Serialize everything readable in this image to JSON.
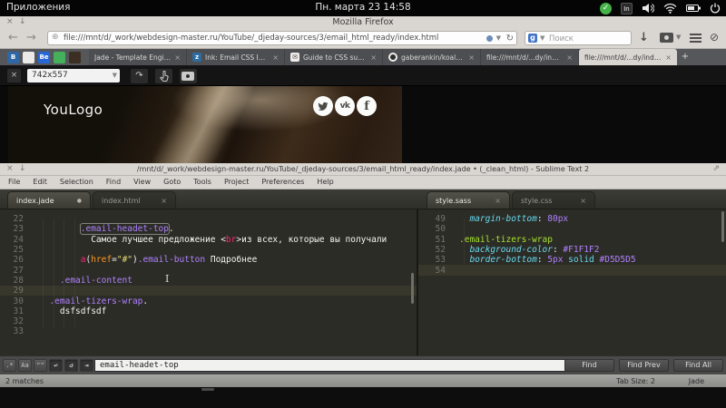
{
  "desktop": {
    "apps_label": "Приложения",
    "clock": "Пн. марта 23  14:58",
    "tray_icons": [
      "updates",
      "text-tool",
      "volume",
      "wifi",
      "battery",
      "power"
    ]
  },
  "firefox": {
    "window_title": "Mozilla Firefox",
    "url": "file:///mnt/d/_work/webdesign-master.ru/YouTube/_djeday-sources/3/email_html_ready/index.html",
    "search_placeholder": "Поиск",
    "bookmarks": [
      {
        "name": "bootstrap",
        "glyph": "B",
        "bg": "#2f67a6",
        "fg": "#ffffff"
      },
      {
        "name": "red-doc",
        "glyph": "",
        "bg": "#eceae8",
        "fg": "#cc3333"
      },
      {
        "name": "behance",
        "glyph": "Be",
        "bg": "#2766d6",
        "fg": "#ffffff"
      },
      {
        "name": "koala-green",
        "glyph": "",
        "bg": "#45b05c",
        "fg": "#ffffff"
      },
      {
        "name": "dark-folder",
        "glyph": "",
        "bg": "#3c2e22",
        "fg": "#ffffff"
      }
    ],
    "tabs": [
      {
        "label": "Jade - Template Engine",
        "icon": null,
        "active": false
      },
      {
        "label": "Ink: Email CSS Inliner",
        "icon": "ink",
        "active": false
      },
      {
        "label": "Guide to CSS support i...",
        "icon": "mail",
        "active": false
      },
      {
        "label": "gaberankin/koala-jade",
        "icon": "github",
        "active": false
      },
      {
        "label": "file:///mnt/d/...dy/index.html",
        "icon": null,
        "active": false
      },
      {
        "label": "file:///mnt/d/...dy/index.html",
        "icon": null,
        "active": true
      }
    ],
    "favicon_glyphs": {
      "ink": "z",
      "mail": "✉",
      "github": ""
    },
    "new_tab_label": "+",
    "close_glyph": "×",
    "responsive": {
      "size_value": "742x557"
    },
    "page": {
      "logo_text": "YouLogo",
      "social": [
        "twitter",
        "vk",
        "facebook"
      ],
      "vk_glyph": "vk",
      "facebook_glyph": "f"
    }
  },
  "sublime": {
    "window_title": "/mnt/d/_work/webdesign-master.ru/YouTube/_djeday-sources/3/email_html_ready/index.jade • (_clean_html) - Sublime Text 2",
    "menu_items": [
      "File",
      "Edit",
      "Selection",
      "Find",
      "View",
      "Goto",
      "Tools",
      "Project",
      "Preferences",
      "Help"
    ],
    "left_group_tabs": [
      {
        "label": "index.jade",
        "active": true,
        "modified": true
      },
      {
        "label": "index.html",
        "active": false,
        "modified": false
      }
    ],
    "right_group_tabs": [
      {
        "label": "style.sass",
        "active": true,
        "modified": false
      },
      {
        "label": "style.css",
        "active": false,
        "modified": false
      }
    ],
    "left_pane_lines": [
      {
        "n": "22",
        "tokens": []
      },
      {
        "n": "23",
        "tokens": [
          {
            "t": "        ",
            "c": "fg"
          },
          {
            "t": ".email-headet-top",
            "c": "purple",
            "match": true
          },
          {
            "t": ".",
            "c": "fg"
          }
        ]
      },
      {
        "n": "24",
        "tokens": [
          {
            "t": "          Самое лучшее предложение ",
            "c": "fg"
          },
          {
            "t": "<",
            "c": "fg"
          },
          {
            "t": "br",
            "c": "pink"
          },
          {
            "t": ">",
            "c": "fg"
          },
          {
            "t": "из всех, которые вы получали",
            "c": "fg"
          }
        ]
      },
      {
        "n": "25",
        "tokens": []
      },
      {
        "n": "26",
        "tokens": [
          {
            "t": "        ",
            "c": "fg"
          },
          {
            "t": "a",
            "c": "pink"
          },
          {
            "t": "(",
            "c": "fg"
          },
          {
            "t": "href",
            "c": "orange"
          },
          {
            "t": "=",
            "c": "fg"
          },
          {
            "t": "\"#\"",
            "c": "yellow"
          },
          {
            "t": ")",
            "c": "fg"
          },
          {
            "t": ".email-button",
            "c": "purple"
          },
          {
            "t": " Подробнее",
            "c": "fg"
          }
        ]
      },
      {
        "n": "27",
        "tokens": []
      },
      {
        "n": "28",
        "tokens": [
          {
            "t": "    ",
            "c": "fg"
          },
          {
            "t": ".email-content",
            "c": "purple"
          }
        ]
      },
      {
        "n": "29",
        "tokens": [],
        "current": true
      },
      {
        "n": "30",
        "tokens": [
          {
            "t": "  ",
            "c": "fg"
          },
          {
            "t": ".email-tizers-wrap",
            "c": "purple"
          },
          {
            "t": ".",
            "c": "fg"
          }
        ]
      },
      {
        "n": "31",
        "tokens": [
          {
            "t": "    ",
            "c": "fg"
          },
          {
            "t": "dsfsdfsdf",
            "c": "fg"
          }
        ]
      },
      {
        "n": "32",
        "tokens": []
      },
      {
        "n": "33",
        "tokens": []
      }
    ],
    "right_pane_lines": [
      {
        "n": "49",
        "tokens": [
          {
            "t": "  ",
            "c": "fg"
          },
          {
            "t": "margin-bottom",
            "c": "cyani"
          },
          {
            "t": ": ",
            "c": "fg"
          },
          {
            "t": "80px",
            "c": "purple"
          }
        ]
      },
      {
        "n": "50",
        "tokens": []
      },
      {
        "n": "51",
        "tokens": [
          {
            "t": ".email-tizers-wrap",
            "c": "green"
          }
        ]
      },
      {
        "n": "52",
        "tokens": [
          {
            "t": "  ",
            "c": "fg"
          },
          {
            "t": "background-color",
            "c": "cyani"
          },
          {
            "t": ": ",
            "c": "fg"
          },
          {
            "t": "#F1F1F2",
            "c": "purple"
          }
        ]
      },
      {
        "n": "53",
        "tokens": [
          {
            "t": "  ",
            "c": "fg"
          },
          {
            "t": "border-bottom",
            "c": "cyani"
          },
          {
            "t": ": ",
            "c": "fg"
          },
          {
            "t": "5px",
            "c": "purple"
          },
          {
            "t": " ",
            "c": "fg"
          },
          {
            "t": "solid",
            "c": "cyan"
          },
          {
            "t": " ",
            "c": "fg"
          },
          {
            "t": "#D5D5D5",
            "c": "purple"
          }
        ]
      },
      {
        "n": "54",
        "tokens": [],
        "current": true
      }
    ],
    "find_bar": {
      "toggles": [
        {
          "name": "regex",
          "glyph": ".*",
          "on": false
        },
        {
          "name": "case-sensitive",
          "glyph": "Aa",
          "on": false
        },
        {
          "name": "whole-word",
          "glyph": "\"\"",
          "on": false
        },
        {
          "name": "wrap",
          "glyph": "↩",
          "on": true
        },
        {
          "name": "in-selection",
          "glyph": "↺",
          "on": true
        },
        {
          "name": "highlight-matches",
          "glyph": "⇥",
          "on": true
        },
        {
          "name": "preserve-case",
          "glyph": "□",
          "on": false
        }
      ],
      "query": "email-headet-top",
      "buttons": [
        "Find",
        "Find Prev",
        "Find All"
      ]
    },
    "status_bar": {
      "matches": "2 matches",
      "tab_size": "Tab Size: 2",
      "syntax": "Jade"
    }
  },
  "colors": {
    "monokai_purple": "#ae81ff",
    "monokai_pink": "#f92672",
    "monokai_yellow": "#e6db74",
    "monokai_green": "#a6e22e",
    "monokai_cyan": "#66d9ef",
    "monokai_orange": "#fd971f",
    "editor_bg": "#2c2c26",
    "chrome_gray": "#d9d5d1",
    "tabstrip_gray": "#55575a"
  }
}
